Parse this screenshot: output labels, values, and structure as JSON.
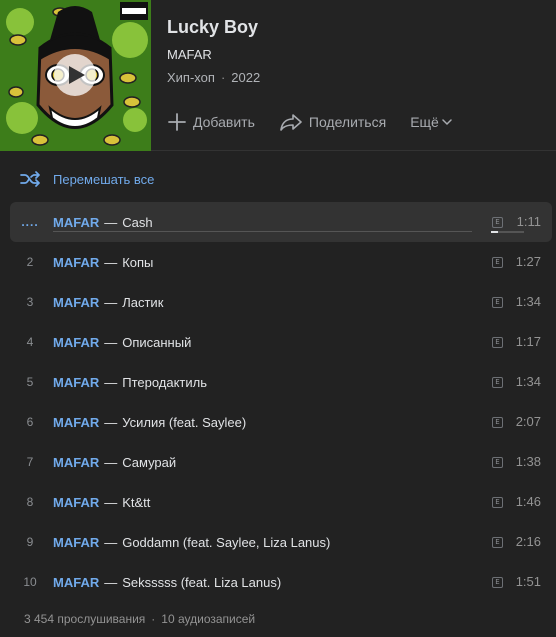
{
  "album": {
    "title": "Lucky Boy",
    "artist": "MAFAR",
    "genre": "Хип-хоп",
    "year": "2022",
    "cover_parental_advisory": "PARENTAL ADVISORY EXPLICIT CONTENT"
  },
  "actions": {
    "add_label": "Добавить",
    "share_label": "Поделиться",
    "more_label": "Ещё"
  },
  "shuffle_label": "Перемешать все",
  "tracks": [
    {
      "num": "....",
      "artist": "MAFAR",
      "title": "Cash",
      "explicit": "E",
      "duration": "1:11",
      "playing": true,
      "progress": 0.0,
      "volume": 0.2
    },
    {
      "num": "2",
      "artist": "MAFAR",
      "title": "Копы",
      "explicit": "E",
      "duration": "1:27"
    },
    {
      "num": "3",
      "artist": "MAFAR",
      "title": "Ластик",
      "explicit": "E",
      "duration": "1:34"
    },
    {
      "num": "4",
      "artist": "MAFAR",
      "title": "Описанный",
      "explicit": "E",
      "duration": "1:17"
    },
    {
      "num": "5",
      "artist": "MAFAR",
      "title": "Птеродактиль",
      "explicit": "E",
      "duration": "1:34"
    },
    {
      "num": "6",
      "artist": "MAFAR",
      "title": "Усилия (feat. Saylee)",
      "explicit": "E",
      "duration": "2:07"
    },
    {
      "num": "7",
      "artist": "MAFAR",
      "title": "Самурай",
      "explicit": "E",
      "duration": "1:38"
    },
    {
      "num": "8",
      "artist": "MAFAR",
      "title": "Kt&tt",
      "explicit": "E",
      "duration": "1:46"
    },
    {
      "num": "9",
      "artist": "MAFAR",
      "title": "Goddamn (feat. Saylee, Liza Lanus)",
      "explicit": "E",
      "duration": "2:16"
    },
    {
      "num": "10",
      "artist": "MAFAR",
      "title": "Seksssss (feat. Liza Lanus)",
      "explicit": "E",
      "duration": "1:51"
    }
  ],
  "footer": {
    "plays": "3 454 прослушивания",
    "count": "10 аудиозаписей"
  },
  "colors": {
    "background": "#222222",
    "accent": "#71aaeb",
    "text": "#e1e3e6",
    "muted": "#939393"
  },
  "icons": [
    "play-icon",
    "plus-icon",
    "share-arrow-icon",
    "chevron-down-icon",
    "shuffle-icon",
    "explicit-icon"
  ]
}
